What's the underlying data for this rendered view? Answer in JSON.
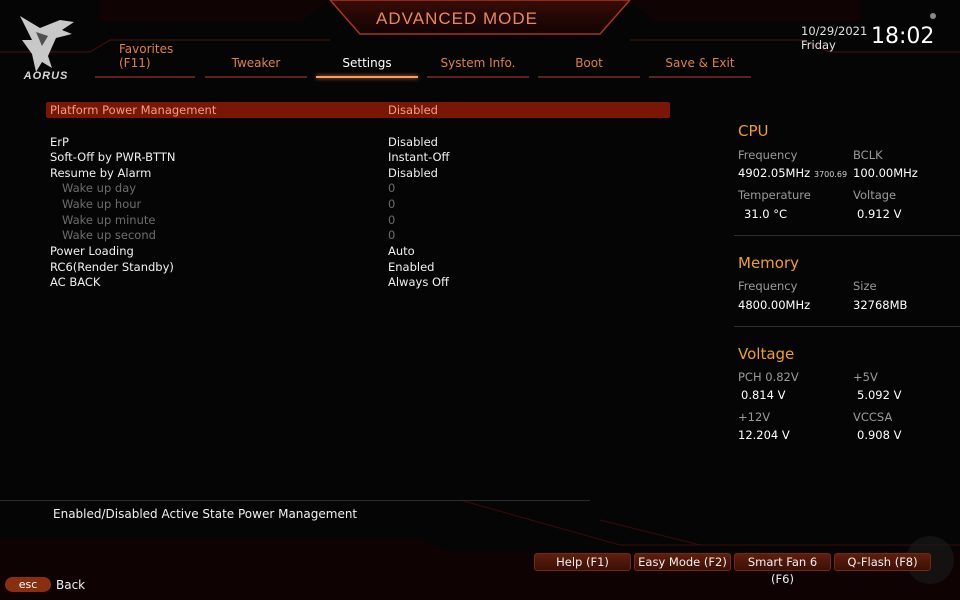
{
  "header": {
    "mode_title": "ADVANCED MODE",
    "brand": "AORUS",
    "date": "10/29/2021",
    "day": "Friday",
    "time": "18:02"
  },
  "tabs": [
    {
      "label": "Favorites\n(F11)",
      "active": false
    },
    {
      "label": "Tweaker",
      "active": false
    },
    {
      "label": "Settings",
      "active": true
    },
    {
      "label": "System Info.",
      "active": false
    },
    {
      "label": "Boot",
      "active": false
    },
    {
      "label": "Save & Exit",
      "active": false
    }
  ],
  "settings": {
    "selected": {
      "label": "Platform Power Management",
      "value": "Disabled"
    },
    "rows": [
      {
        "label": "ErP",
        "value": "Disabled",
        "enabled": true
      },
      {
        "label": "Soft-Off by PWR-BTTN",
        "value": "Instant-Off",
        "enabled": true
      },
      {
        "label": "Resume by Alarm",
        "value": "Disabled",
        "enabled": true
      },
      {
        "label": "Wake up day",
        "value": "0",
        "enabled": false
      },
      {
        "label": "Wake up hour",
        "value": "0",
        "enabled": false
      },
      {
        "label": "Wake up minute",
        "value": "0",
        "enabled": false
      },
      {
        "label": "Wake up second",
        "value": "0",
        "enabled": false
      },
      {
        "label": "Power Loading",
        "value": "Auto",
        "enabled": true
      },
      {
        "label": "RC6(Render Standby)",
        "value": "Enabled",
        "enabled": true
      },
      {
        "label": "AC BACK",
        "value": "Always Off",
        "enabled": true
      }
    ]
  },
  "hardware": {
    "cpu": {
      "title": "CPU",
      "frequency_label": "Frequency",
      "frequency": "4902.05MHz",
      "frequency_sub": "3700.69",
      "bclk_label": "BCLK",
      "bclk": "100.00MHz",
      "temperature_label": "Temperature",
      "temperature": "31.0 °C",
      "voltage_label": "Voltage",
      "voltage": "0.912 V"
    },
    "memory": {
      "title": "Memory",
      "frequency_label": "Frequency",
      "frequency": "4800.00MHz",
      "size_label": "Size",
      "size": "32768MB"
    },
    "voltage": {
      "title": "Voltage",
      "pch_label": "PCH 0.82V",
      "pch": "0.814 V",
      "v5_label": "+5V",
      "v5": "5.092 V",
      "v12_label": "+12V",
      "v12": "12.204 V",
      "vccsa_label": "VCCSA",
      "vccsa": "0.908 V"
    }
  },
  "help_text": "Enabled/Disabled Active State Power Management",
  "function_keys": [
    {
      "label": "Help (F1)"
    },
    {
      "label": "Easy Mode (F2)"
    },
    {
      "label": "Smart Fan 6 (F6)"
    },
    {
      "label": "Q-Flash (F8)"
    }
  ],
  "esc": {
    "key": "esc",
    "label": "Back"
  },
  "colors": {
    "accent": "#e0803f",
    "highlight": "#7a1606",
    "hw_title": "#f0a020"
  }
}
